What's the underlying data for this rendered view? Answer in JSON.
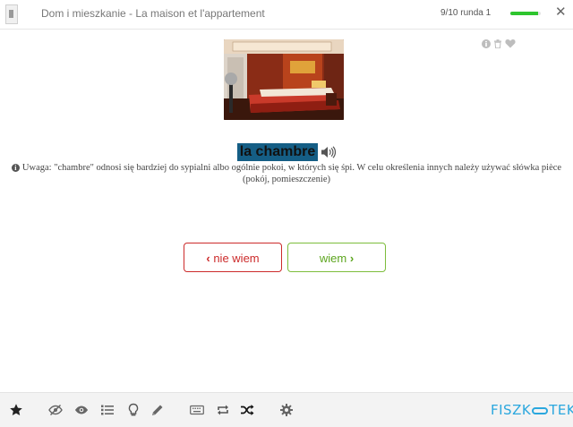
{
  "header": {
    "deck_title": "Dom i mieszkanie - La maison et l'appartement",
    "progress_text": "9/10 runda 1",
    "progress_fraction": 0.9,
    "close_label": "✕"
  },
  "card": {
    "image_icon": "bedroom-photo",
    "word": "la chambre",
    "note_icon": "info-icon",
    "note": "Uwaga: \"chambre\" odnosi się bardziej do sypialni albo ogólnie pokoi, w których się śpi. W celu określenia innych należy używać słówka pièce (pokój, pomieszczenie)",
    "actions": [
      "info-icon",
      "trash-icon",
      "heart-icon"
    ]
  },
  "buttons": {
    "dont_know_label": "nie wiem",
    "know_label": "wiem"
  },
  "toolbar": {
    "items": [
      "star-icon",
      "eye-slash-icon",
      "eye-icon",
      "list-icon",
      "lightbulb-icon",
      "pencil-icon",
      "keyboard-icon",
      "repeat-icon",
      "shuffle-icon",
      "gear-icon"
    ]
  },
  "logo": {
    "left": "FISZK",
    "right": "TEKA"
  },
  "colors": {
    "word_highlight": "#155e85",
    "dont_know": "#cc2b2b",
    "know": "#5ca51e",
    "progress": "#2ec52e",
    "logo": "#2aa7de"
  }
}
